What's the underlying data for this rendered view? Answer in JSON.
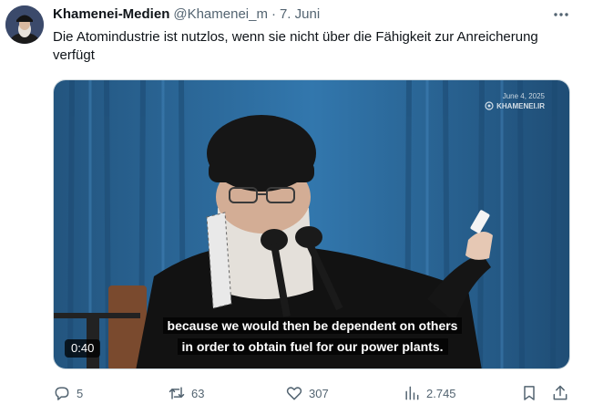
{
  "tweet": {
    "author_name": "Khamenei-Medien",
    "handle": "@Khamenei_m",
    "separator": "·",
    "date": "7. Juni",
    "text": "Die Atomindustrie ist nutzlos, wenn sie nicht über die Fähigkeit zur Anreicherung verfügt"
  },
  "video": {
    "watermark_date": "June 4, 2025",
    "watermark_brand": "KHAMENEI.IR",
    "subtitle_line1": "because we would then be dependent on others",
    "subtitle_line2": "in order to obtain fuel for our power plants.",
    "duration": "0:40"
  },
  "actions": {
    "replies": "5",
    "reposts": "63",
    "likes": "307",
    "views": "2.745"
  },
  "colors": {
    "text_primary": "#0f1419",
    "text_secondary": "#536471",
    "curtain_blue": "#2f6fa6",
    "turban_black": "#161616"
  },
  "icons": {
    "reply": "reply-bubble-icon",
    "repost": "repost-arrows-icon",
    "like": "heart-icon",
    "views": "bar-chart-icon",
    "bookmark": "bookmark-icon",
    "share": "share-upload-icon",
    "more": "more-dots-icon"
  }
}
